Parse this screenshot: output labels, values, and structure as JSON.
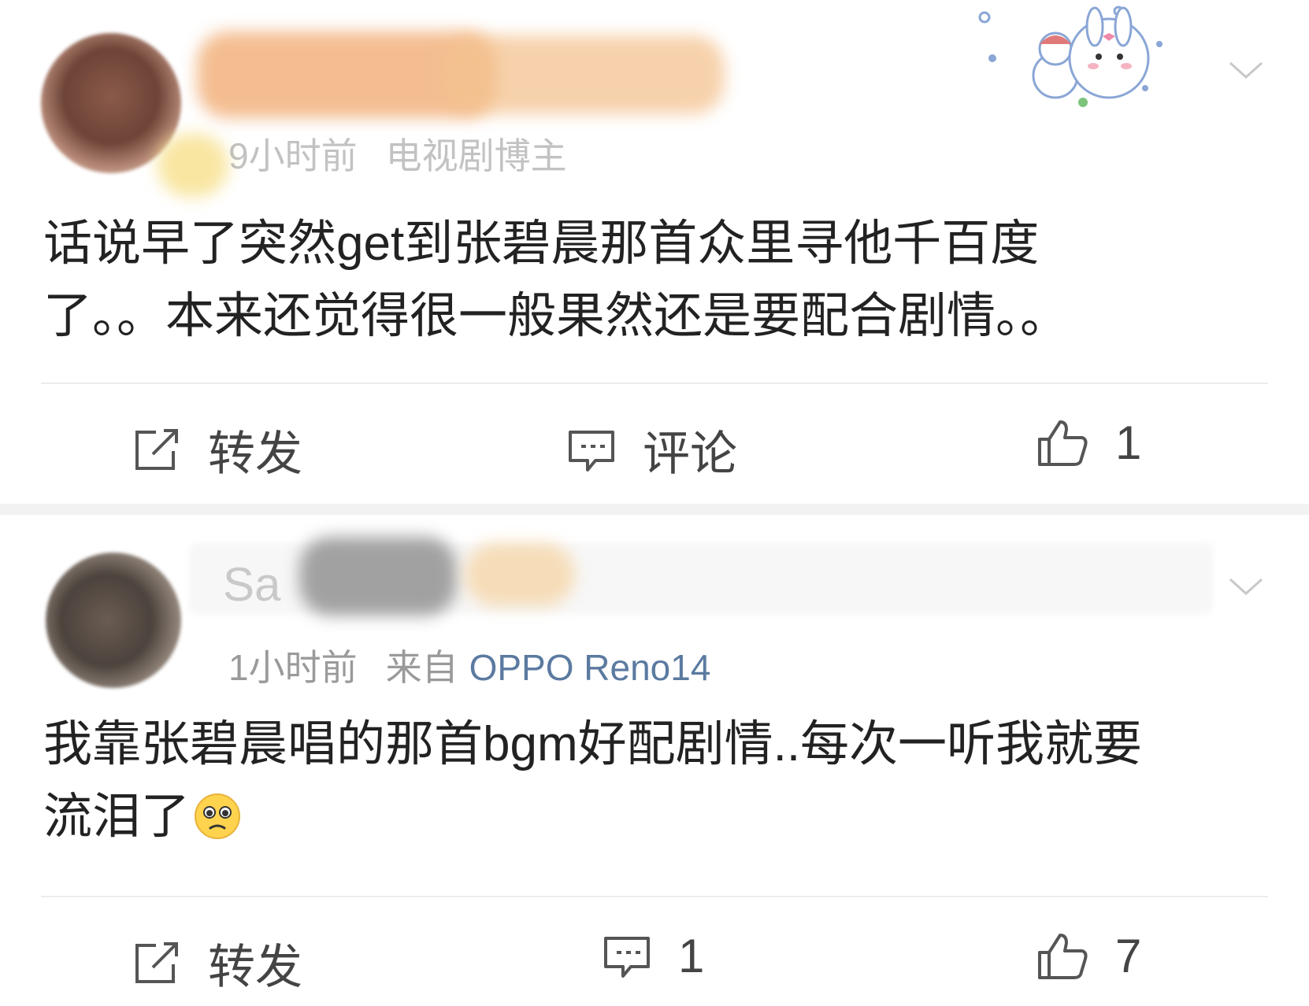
{
  "posts": [
    {
      "time": "9小时前",
      "badge": "电视剧博主",
      "text_line1": "话说早了突然get到张碧晨那首众里寻他千百度",
      "text_line2": "了。。本来还觉得很一般果然还是要配合剧情。。",
      "actions": {
        "share": "转发",
        "comment": "评论",
        "like": "1"
      }
    },
    {
      "name_fragment": "Sa",
      "time": "1小时前",
      "source_prefix": "来自",
      "device": "OPPO Reno14",
      "text_line1": "我靠张碧晨唱的那首bgm好配剧情..每次一听我就要",
      "text_line2": "流泪了",
      "actions": {
        "share": "转发",
        "comment": "1",
        "like": "7"
      }
    }
  ],
  "icons": {
    "share": "share-icon",
    "comment": "comment-icon",
    "like": "thumbs-up-icon",
    "more": "chevron-down-icon",
    "emoji": "pleading-face-emoji",
    "sticker": "snowman-bunny-sticker"
  },
  "colors": {
    "text": "#222222",
    "meta": "#9a9a9a",
    "device_link": "#5b7aa0",
    "separator": "#f2f2f2"
  }
}
